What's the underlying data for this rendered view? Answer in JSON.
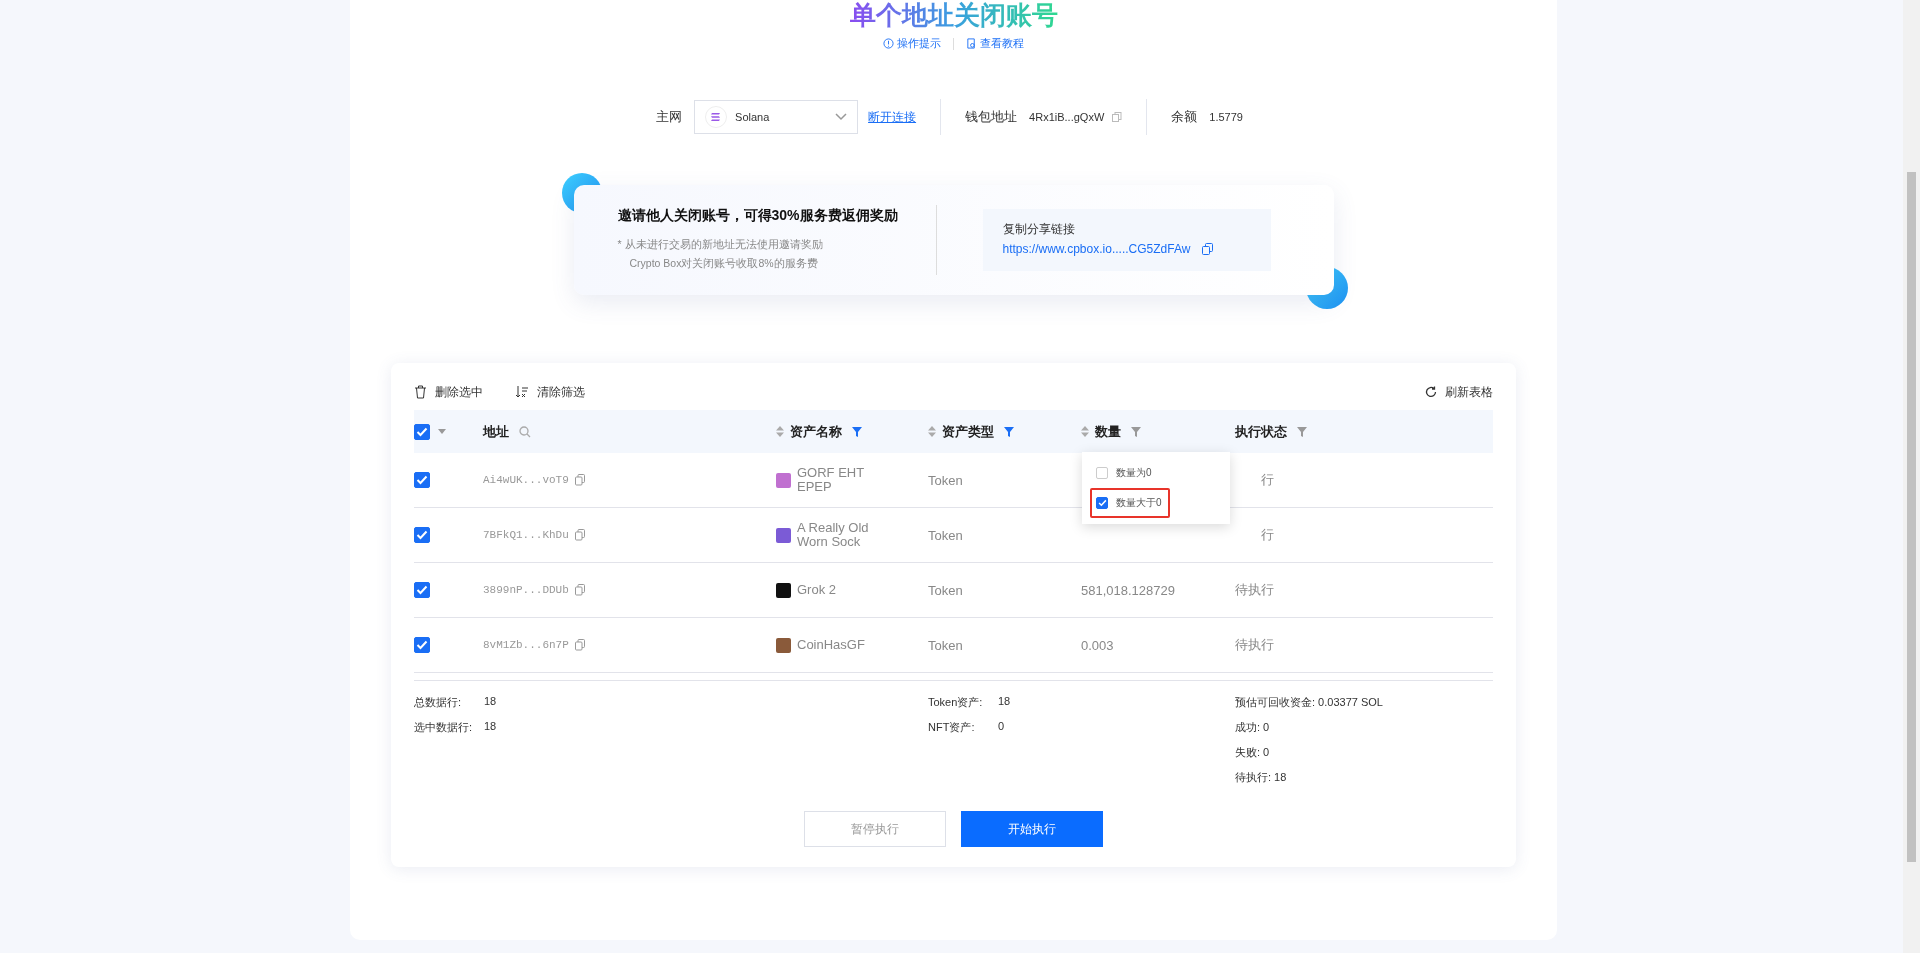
{
  "title": "单个地址关闭账号",
  "title_links": [
    {
      "label": "操作提示",
      "kind": "info"
    },
    {
      "label": "查看教程",
      "kind": "doc"
    }
  ],
  "network": {
    "label": "主网",
    "value": "Solana",
    "disconnect": "断开连接",
    "wallet_label": "钱包地址",
    "wallet": "4Rx1iB...gQxW",
    "balance_label": "余额",
    "balance": "1.5779"
  },
  "invite": {
    "heading": "邀请他人关闭账号，可得30%服务费返佣奖励",
    "notes": [
      "*  从未进行交易的新地址无法使用邀请奖励",
      "Crypto Box对关闭账号收取8%的服务费"
    ],
    "share_label": "复制分享链接",
    "share_link": "https://www.cpbox.io.....CG5ZdFAw"
  },
  "toolbar": {
    "delete": "删除选中",
    "clear": "清除筛选",
    "refresh": "刷新表格"
  },
  "table": {
    "all_checked": true,
    "columns": [
      {
        "label": "地址",
        "kind": "search"
      },
      {
        "label": "资产名称",
        "kind": "sort_filter",
        "filter_active": true
      },
      {
        "label": "资产类型",
        "kind": "sort_filter",
        "filter_active": true
      },
      {
        "label": "数量",
        "kind": "sort_filter",
        "filter_active": false
      },
      {
        "label": "执行状态",
        "kind": "filter",
        "filter_active": false
      }
    ],
    "rows": [
      {
        "checked": true,
        "address": "Ai4wUK...voT9",
        "name": "GORF EHT EPEP",
        "color": "#c070d0",
        "type": "Token",
        "status": "行",
        "status_covered": true
      },
      {
        "checked": true,
        "address": "7BFkQ1...KhDu",
        "name": "A Really Old Worn Sock",
        "color": "#7b5bd6",
        "type": "Token",
        "status": "行",
        "status_covered": true
      },
      {
        "checked": true,
        "address": "3899nP...DDUb",
        "name": "Grok 2",
        "color": "#111111",
        "type": "Token",
        "quantity": "581,018.128729",
        "status": "待执行",
        "status_covered": false
      },
      {
        "checked": true,
        "address": "8vM1Zb...6n7P",
        "name": "CoinHasGF",
        "color": "#8a5a3a",
        "type": "Token",
        "quantity": "0.003",
        "status": "待执行",
        "status_covered": false
      }
    ],
    "filter_menu": [
      {
        "label": "数量为0",
        "checked": false,
        "highlighted": false
      },
      {
        "label": "数量大于0",
        "checked": true,
        "highlighted": true
      }
    ]
  },
  "stats": {
    "left": [
      {
        "label": "总数据行:",
        "value": "18"
      },
      {
        "label": "选中数据行:",
        "value": "18"
      }
    ],
    "middle": [
      {
        "label": "Token资产:",
        "value": "18"
      },
      {
        "label": "NFT资产:",
        "value": "0"
      }
    ],
    "right": [
      "预估可回收资金: 0.03377 SOL",
      "成功: 0",
      "失败: 0",
      "待执行: 18"
    ]
  },
  "buttons": [
    {
      "label": "暂停执行",
      "disabled": true,
      "primary": false
    },
    {
      "label": "开始执行",
      "disabled": false,
      "primary": true
    }
  ]
}
